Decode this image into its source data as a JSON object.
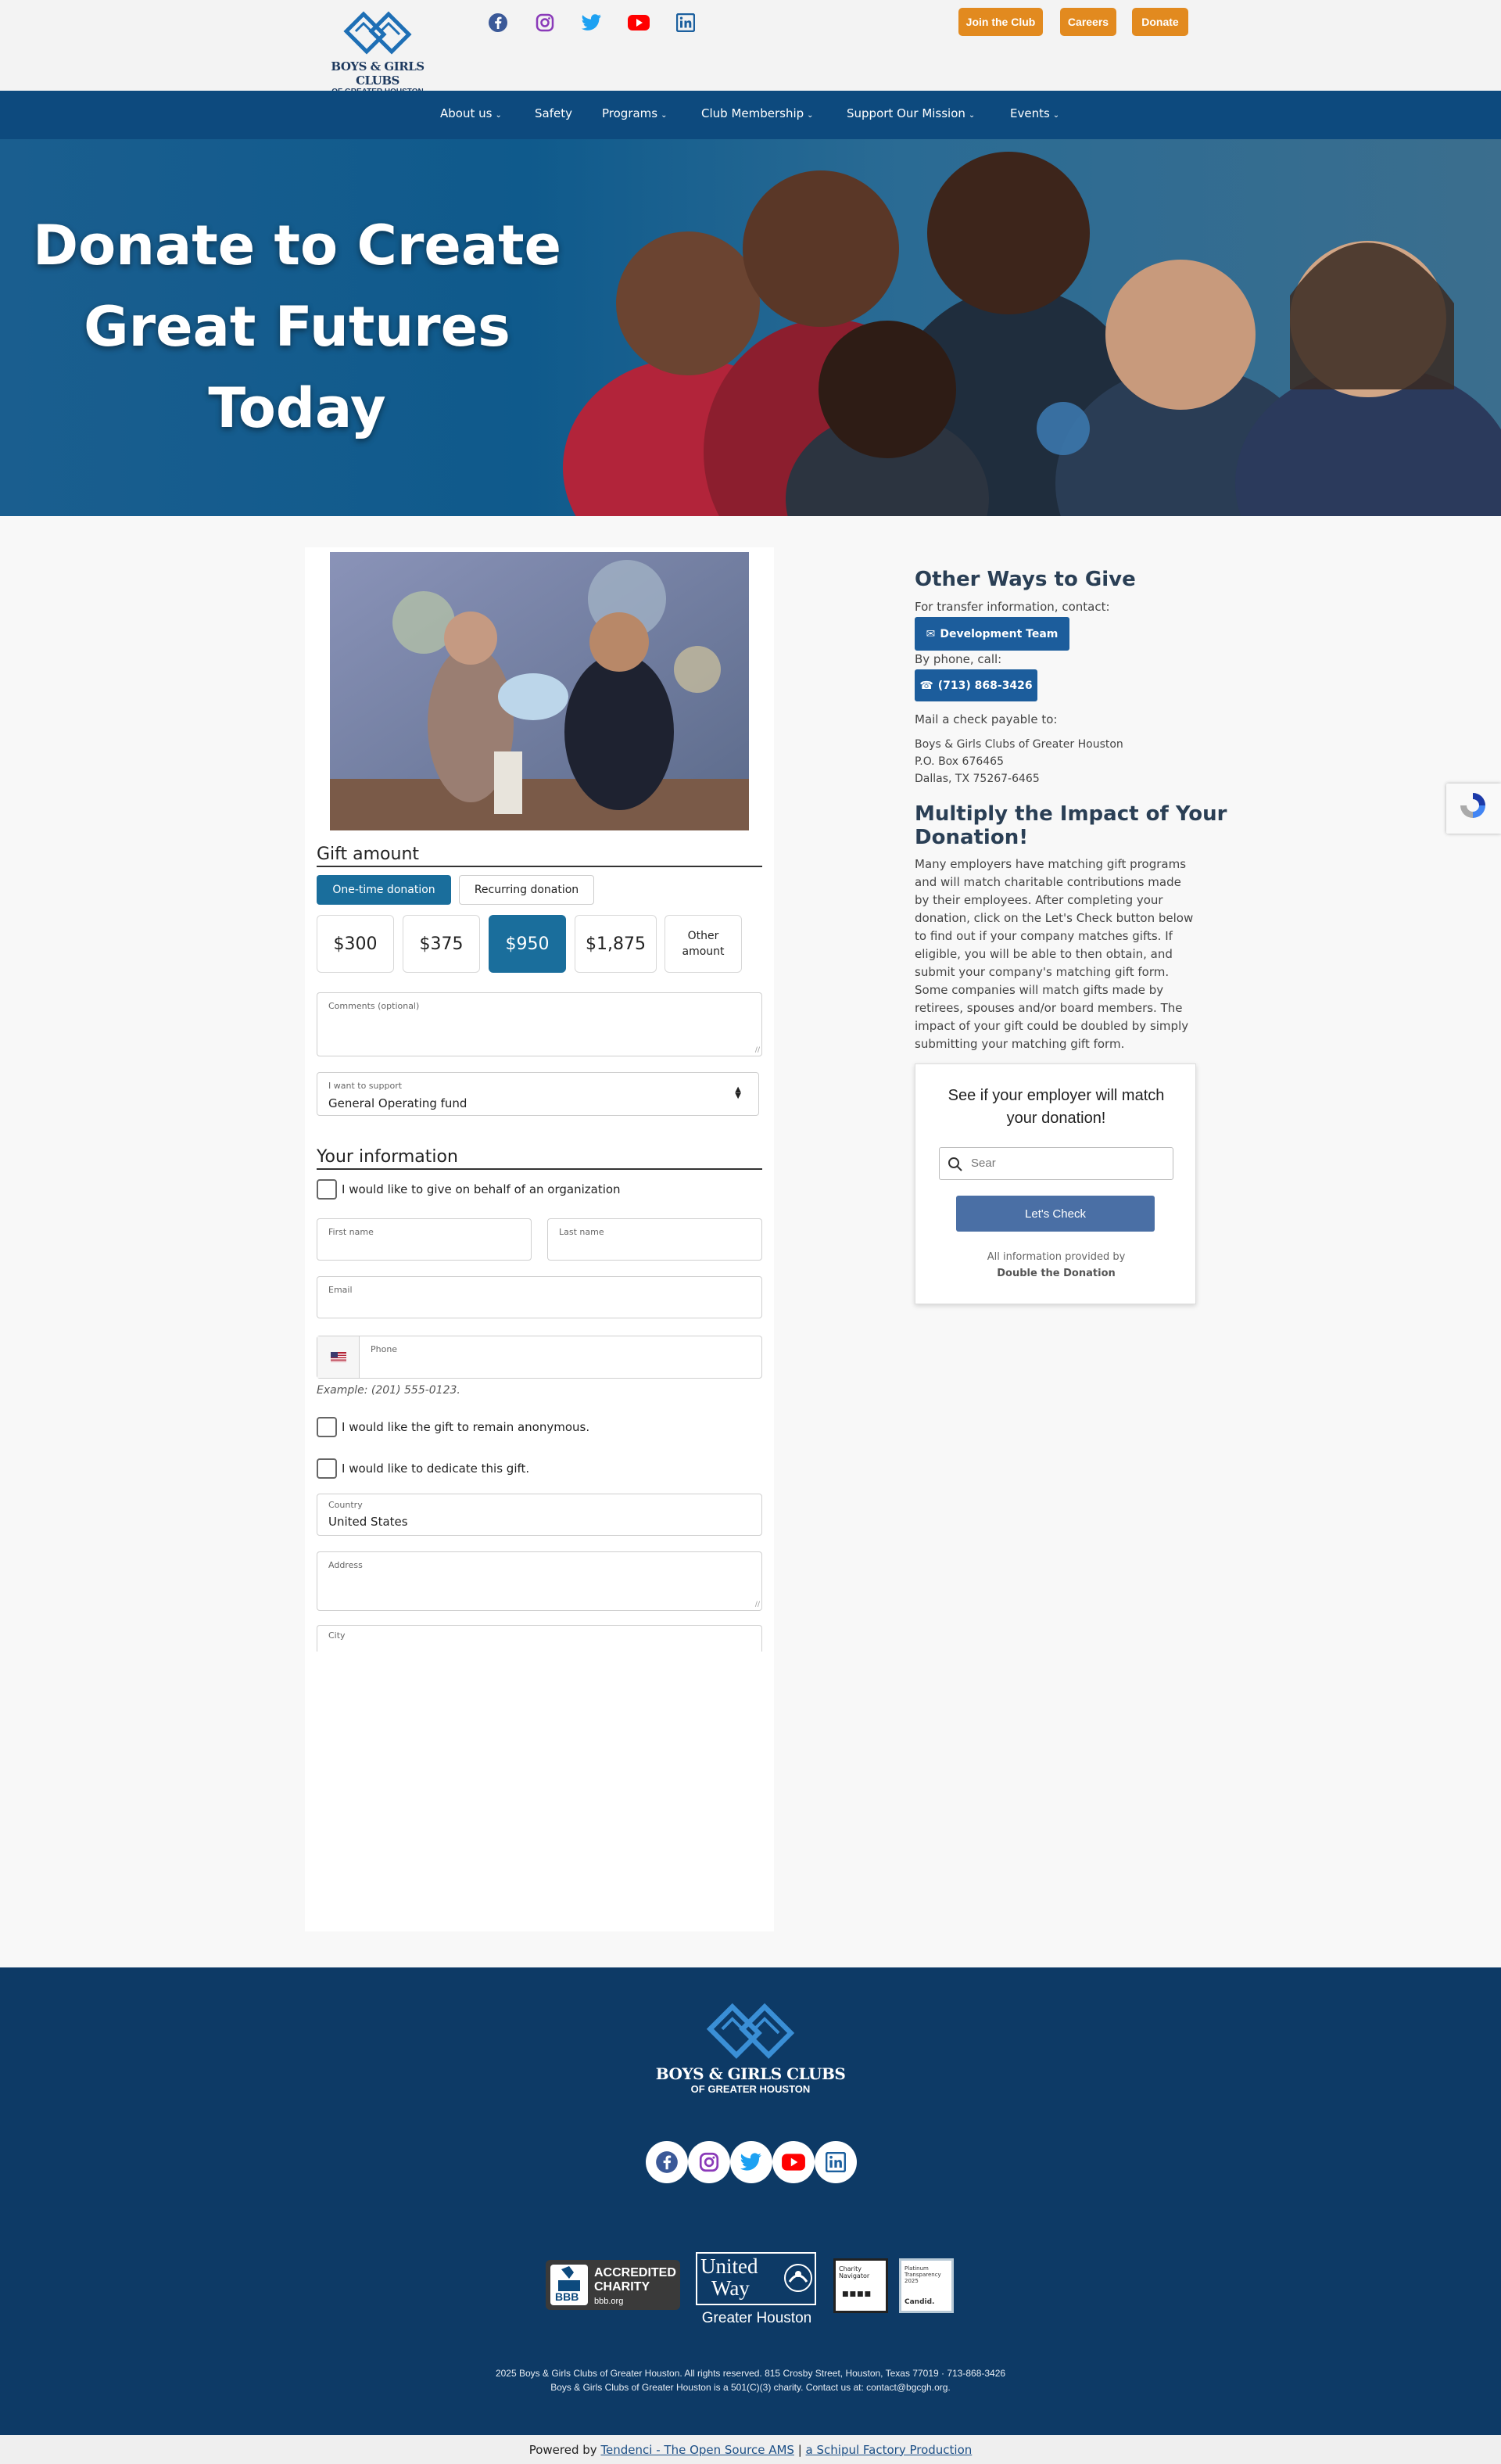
{
  "header": {
    "logo_line1": "BOYS & GIRLS CLUBS",
    "logo_line2": "OF GREATER HOUSTON",
    "buttons": [
      "Join the Club",
      "Careers",
      "Donate"
    ]
  },
  "social_icons": [
    "facebook-icon",
    "instagram-icon",
    "twitter-icon",
    "youtube-icon",
    "linkedin-icon"
  ],
  "nav": {
    "items": [
      {
        "label": "About us",
        "dropdown": true
      },
      {
        "label": "Safety",
        "dropdown": false
      },
      {
        "label": "Programs",
        "dropdown": true
      },
      {
        "label": "Club Membership",
        "dropdown": true
      },
      {
        "label": "Support Our Mission",
        "dropdown": true
      },
      {
        "label": "Events",
        "dropdown": true
      }
    ]
  },
  "hero": {
    "title_line1": "Donate to Create",
    "title_line2": "Great Futures",
    "title_line3": "Today"
  },
  "form": {
    "gift_heading": "Gift amount",
    "tabs": [
      "One-time donation",
      "Recurring donation"
    ],
    "amounts": [
      "$300",
      "$375",
      "$950",
      "$1,875"
    ],
    "other_line1": "Other",
    "other_line2": "amount",
    "selected_amount": "$950",
    "comments_label": "Comments (optional)",
    "support_label": "I want to support",
    "support_value": "General Operating fund",
    "info_heading": "Your information",
    "org_checkbox": "I would like to give on behalf of an organization",
    "first_name_label": "First name",
    "last_name_label": "Last name",
    "email_label": "Email",
    "phone_label": "Phone",
    "phone_example": "Example: (201) 555-0123.",
    "anonymous_checkbox": "I would like the gift to remain anonymous.",
    "dedicate_checkbox": "I would like to dedicate this gift.",
    "country_label": "Country",
    "country_value": "United States",
    "address_label": "Address",
    "city_label": "City"
  },
  "sidebar": {
    "other_ways_heading": "Other Ways to Give",
    "transfer_text": "For transfer information, contact:",
    "dev_team_button": "Development Team",
    "phone_text": "By phone, call:",
    "phone_button": "(713) 868-3426",
    "mail_text": "Mail a check payable to:",
    "address_line1": "Boys & Girls Clubs of Greater Houston",
    "address_line2": "P.O. Box 676465",
    "address_line3": "Dallas, TX 75267-6465",
    "multiply_heading_line1": "Multiply the Impact of Your",
    "multiply_heading_line2": "Donation!",
    "multiply_text": "Many employers have matching gift programs and will match charitable contributions made by their employees. After completing your donation, click on the Let's Check button below to find out if your company matches gifts. If eligible, you will be able to then obtain, and submit your company's matching gift form. Some companies will match gifts made by retirees, spouses and/or board members. The impact of your gift could be doubled by simply submitting your matching gift form."
  },
  "widget": {
    "title_line1": "See if your employer will match",
    "title_line2": "your donation!",
    "search_placeholder": "Sear",
    "check_button": "Let's Check",
    "info_line1": "All information provided by",
    "info_line2": "Double the Donation"
  },
  "footer": {
    "logo_line1": "BOYS & GIRLS CLUBS",
    "logo_line2": "OF GREATER HOUSTON",
    "bbb_line1": "ACCREDITED",
    "bbb_line2": "CHARITY",
    "bbb_site": "bbb.org",
    "bbb_abbr": "BBB",
    "uw_line1": "United",
    "uw_line2": "Way",
    "uw_sub": "Greater Houston",
    "cn_line1": "Charity",
    "cn_line2": "Navigator",
    "candid_line1": "Platinum",
    "candid_line2": "Transparency",
    "candid_year": "2025",
    "candid_brand": "Candid.",
    "copyright": "2025 Boys & Girls Clubs of Greater Houston. All rights reserved. 815 Crosby Street, Houston, Texas 77019 · 713-868-3426",
    "charity_note": "Boys & Girls Clubs of Greater Houston is a 501(C)(3) charity. Contact us at: contact@bgcgh.org."
  },
  "bottombar": {
    "powered_by": "Powered by",
    "link1": "Tendenci - The Open Source AMS",
    "sep": "|",
    "link2": "a Schipul Factory Production"
  },
  "colors": {
    "nav_bg": "#0d4a7e",
    "accent_orange": "#e28a1f",
    "selected_blue": "#1a6e9c",
    "footer_bg": "#0d3a66"
  }
}
